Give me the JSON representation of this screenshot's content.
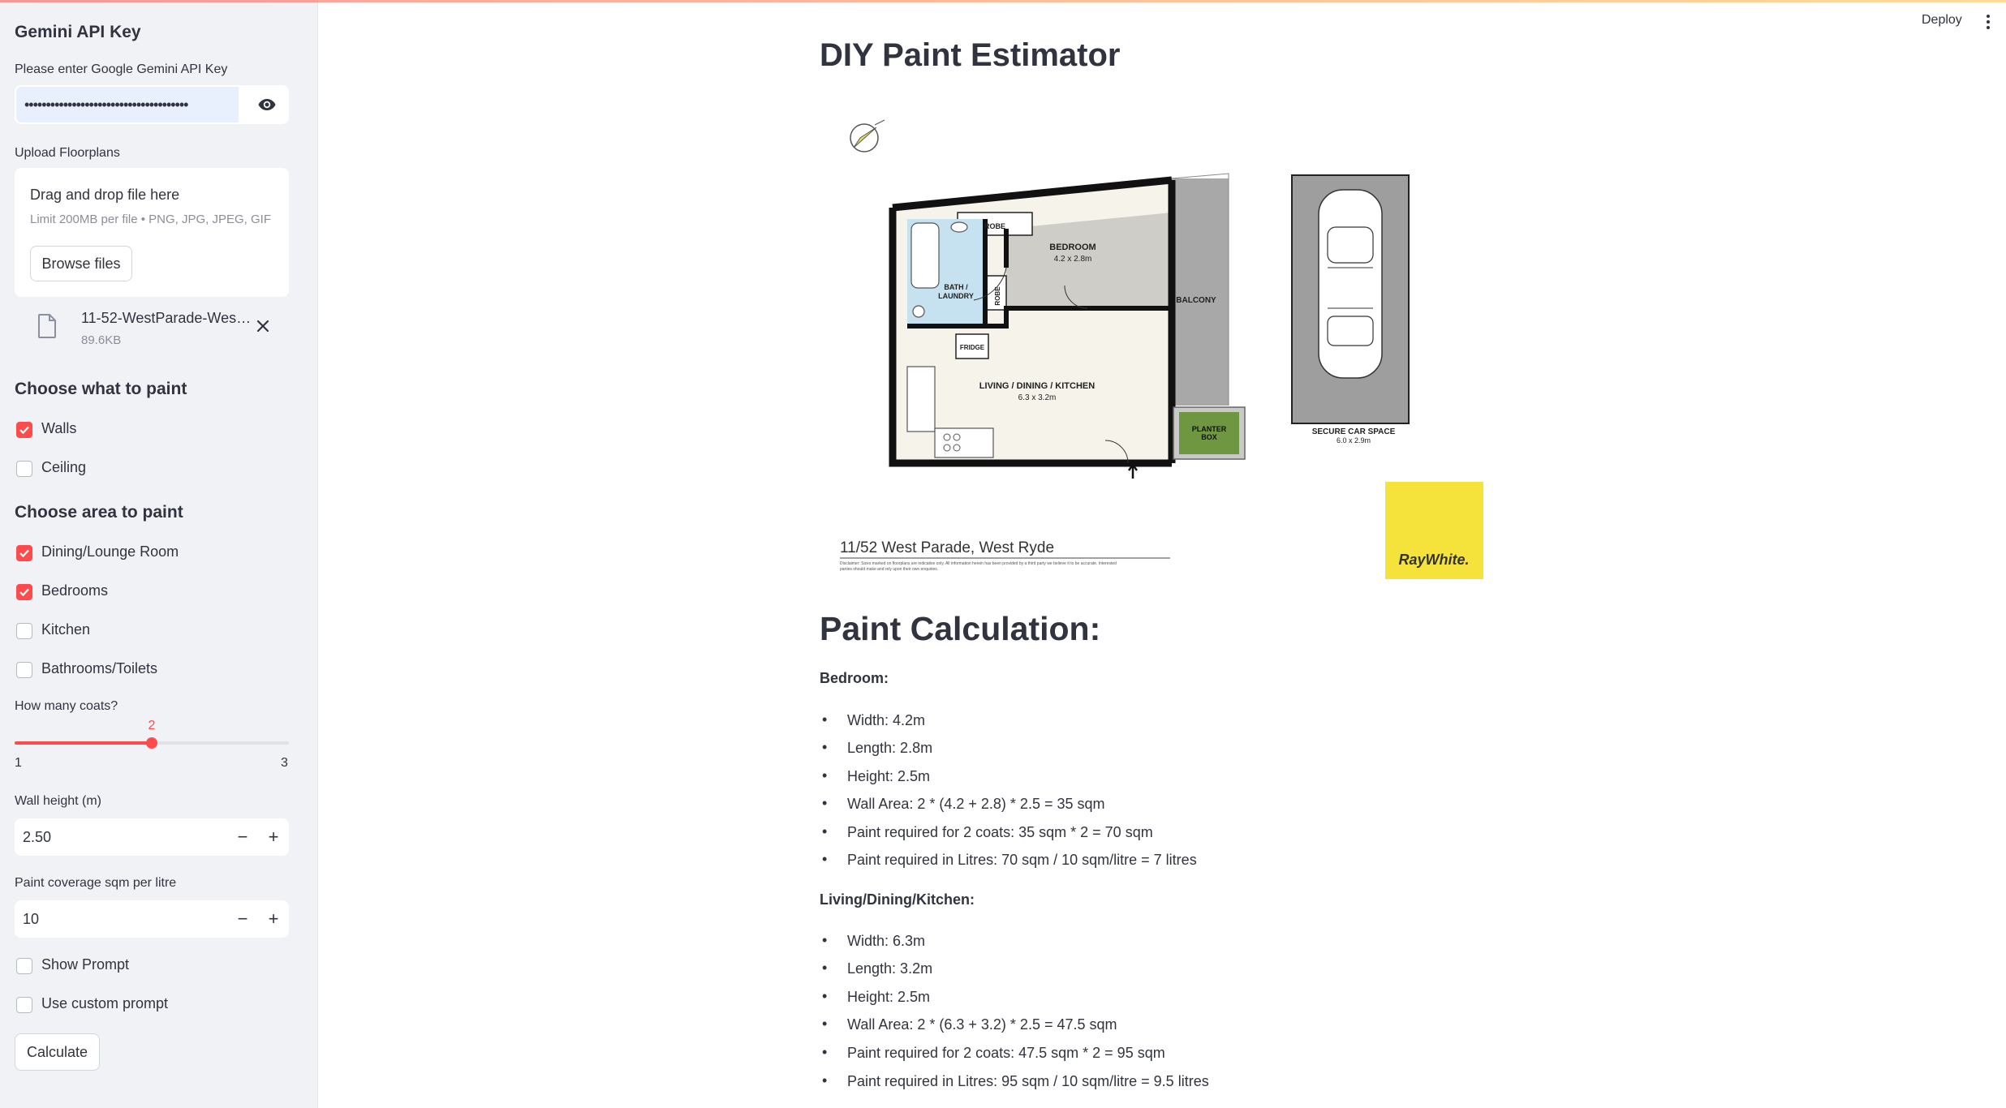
{
  "header": {
    "deploy_label": "Deploy"
  },
  "sidebar": {
    "api_section_title": "Gemini API Key",
    "api_key_label": "Please enter Google Gemini API Key",
    "api_key_value": "••••••••••••••••••••••••••••••••••••••",
    "upload_label": "Upload Floorplans",
    "drop_title": "Drag and drop file here",
    "drop_limit": "Limit 200MB per file • PNG, JPG, JPEG, GIF",
    "browse_label": "Browse files",
    "file_name": "11-52-WestParade-West...",
    "file_size": "89.6KB",
    "paint_what_title": "Choose what to paint",
    "paint_what": [
      {
        "label": "Walls",
        "checked": true
      },
      {
        "label": "Ceiling",
        "checked": false
      }
    ],
    "area_title": "Choose area to paint",
    "areas": [
      {
        "label": "Dining/Lounge Room",
        "checked": true
      },
      {
        "label": "Bedrooms",
        "checked": true
      },
      {
        "label": "Kitchen",
        "checked": false
      },
      {
        "label": "Bathrooms/Toilets",
        "checked": false
      }
    ],
    "coats_label": "How many coats?",
    "coats": {
      "value": "2",
      "min": "1",
      "max": "3"
    },
    "wall_height_label": "Wall height (m)",
    "wall_height_value": "2.50",
    "coverage_label": "Paint coverage sqm per litre",
    "coverage_value": "10",
    "show_prompt_label": "Show Prompt",
    "custom_prompt_label": "Use custom prompt",
    "calculate_label": "Calculate"
  },
  "main": {
    "title": "DIY Paint Estimator",
    "floorplan": {
      "address": "11/52 West Parade, West Ryde",
      "disclaimer_1": "Disclaimer: Sizes marked on floorplans are indicative only. All information herein has been provided by a third party we believe it to be accurate. Interested",
      "disclaimer_2": "parties should make and rely upon their own enquiries.",
      "robe_top": "ROBE",
      "robe_side": "ROBE",
      "bedroom": "BEDROOM",
      "bedroom_size": "4.2 x 2.8m",
      "bath_1": "BATH /",
      "bath_2": "LAUNDRY",
      "balcony": "BALCONY",
      "fridge": "FRIDGE",
      "living": "LIVING / DINING / KITCHEN",
      "living_size": "6.3 x 3.2m",
      "planter_1": "PLANTER",
      "planter_2": "BOX",
      "car_space": "SECURE CAR SPACE",
      "car_size": "6.0 x 2.9m",
      "logo_text": "RayWhite."
    },
    "calc_title": "Paint Calculation:",
    "bedroom_title": "Bedroom:",
    "bedroom_lines": [
      "Width: 4.2m",
      "Length: 2.8m",
      "Height: 2.5m",
      "Wall Area: 2 * (4.2 + 2.8) * 2.5 = 35 sqm",
      "Paint required for 2 coats: 35 sqm * 2 = 70 sqm",
      "Paint required in Litres: 70 sqm / 10 sqm/litre = 7 litres"
    ],
    "living_title": "Living/Dining/Kitchen:",
    "living_lines": [
      "Width: 6.3m",
      "Length: 3.2m",
      "Height: 2.5m",
      "Wall Area: 2 * (6.3 + 3.2) * 2.5 = 47.5 sqm",
      "Paint required for 2 coats: 47.5 sqm * 2 = 95 sqm",
      "Paint required in Litres: 95 sqm / 10 sqm/litre = 9.5 litres"
    ]
  },
  "colors": {
    "accent": "#ff4b4b",
    "sidebar_bg": "#f0f2f6",
    "text": "#31333F",
    "logo_yellow": "#f5e33c"
  }
}
